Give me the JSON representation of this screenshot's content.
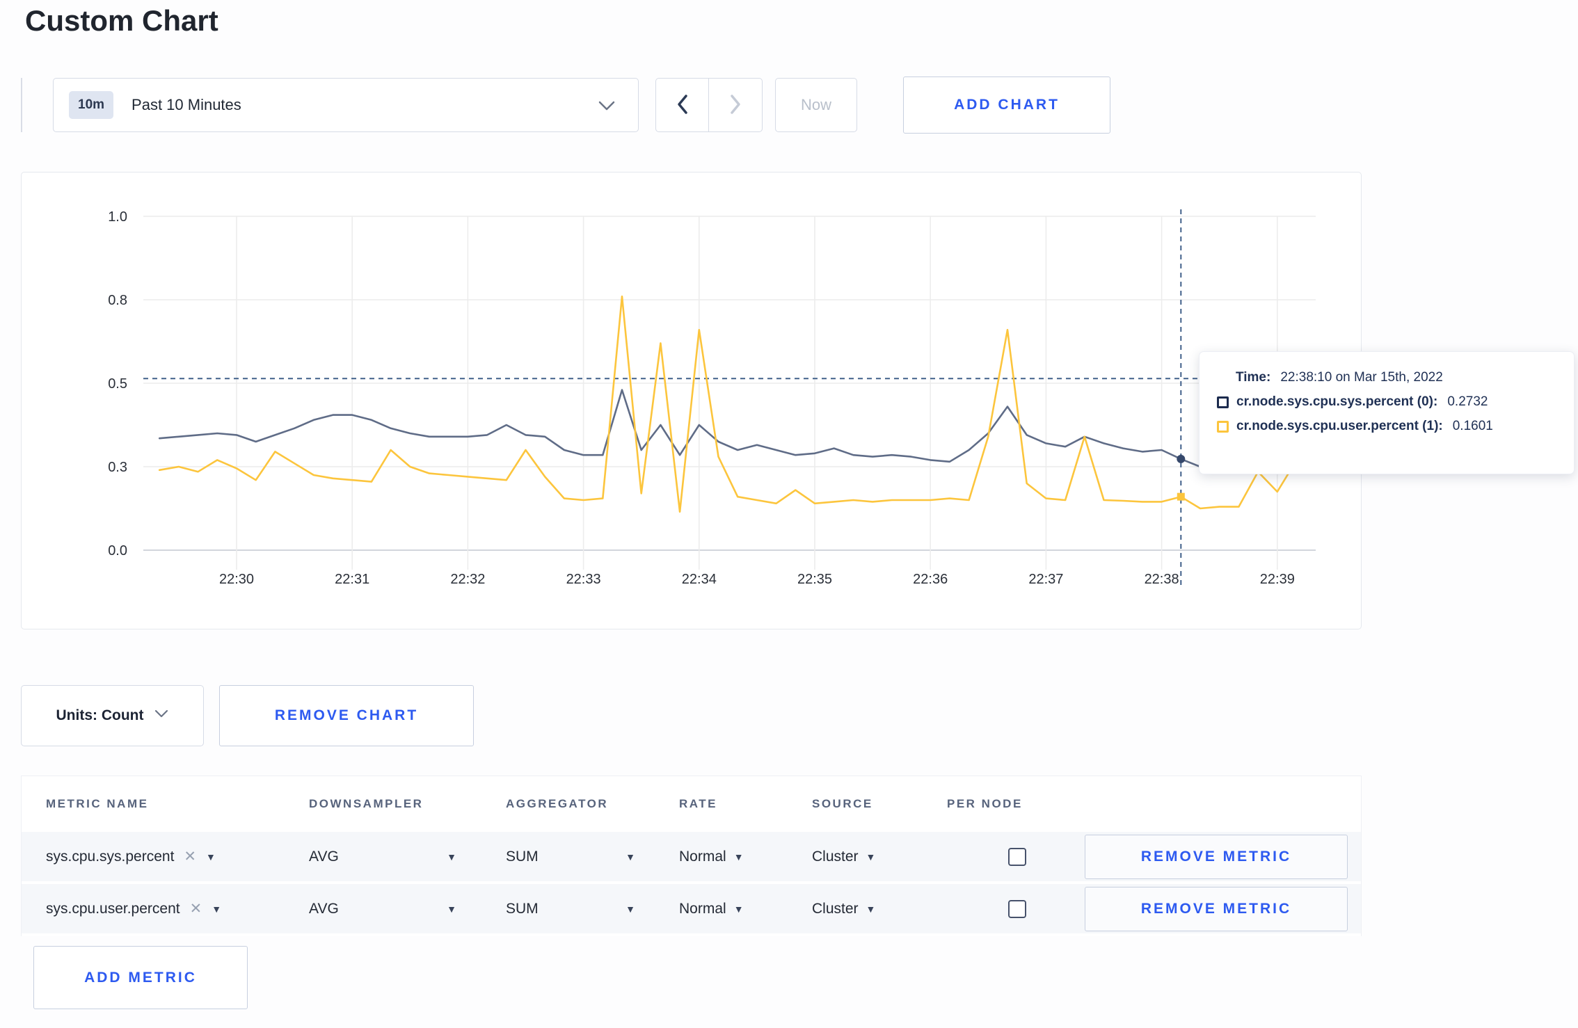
{
  "page": {
    "title": "Custom Chart"
  },
  "toolbar": {
    "time_badge": "10m",
    "time_label": "Past 10 Minutes",
    "now_label": "Now",
    "add_chart_label": "ADD CHART"
  },
  "chart": {
    "tooltip": {
      "time_label": "Time:",
      "time_value": "22:38:10 on Mar 15th, 2022",
      "series": [
        {
          "label": "cr.node.sys.cpu.sys.percent (0):",
          "value": "0.2732",
          "swatch_color": "#1c2b4e"
        },
        {
          "label": "cr.node.sys.cpu.user.percent (1):",
          "value": "0.1601",
          "swatch_color": "#fcc53d"
        }
      ]
    }
  },
  "chart_data": {
    "type": "line",
    "title": "",
    "xlabel": "",
    "ylabel": "",
    "ylim": [
      0,
      1
    ],
    "grid": true,
    "x_start": "22:29:20",
    "x_step_seconds": 10,
    "x_ticks": [
      "22:30",
      "22:31",
      "22:32",
      "22:33",
      "22:34",
      "22:35",
      "22:36",
      "22:37",
      "22:38",
      "22:39"
    ],
    "y_ticks": [
      {
        "value": 0,
        "label": "0.0"
      },
      {
        "value": 0.25,
        "label": "0.3"
      },
      {
        "value": 0.5,
        "label": "0.5"
      },
      {
        "value": 0.75,
        "label": "0.8"
      },
      {
        "value": 1,
        "label": "1.0"
      }
    ],
    "crosshair": {
      "x_index": 53,
      "time": "22:38:10",
      "h_line_value": 0.514
    },
    "series": [
      {
        "name": "cr.node.sys.cpu.sys.percent",
        "color": "#5f6c87",
        "marker_color": "#36486b",
        "values": [
          0.335,
          0.34,
          0.345,
          0.35,
          0.345,
          0.325,
          0.345,
          0.365,
          0.39,
          0.405,
          0.405,
          0.39,
          0.365,
          0.35,
          0.34,
          0.34,
          0.34,
          0.345,
          0.375,
          0.345,
          0.34,
          0.3,
          0.285,
          0.285,
          0.48,
          0.3,
          0.375,
          0.285,
          0.375,
          0.325,
          0.3,
          0.315,
          0.3,
          0.285,
          0.29,
          0.305,
          0.285,
          0.28,
          0.285,
          0.28,
          0.27,
          0.265,
          0.3,
          0.35,
          0.43,
          0.345,
          0.32,
          0.31,
          0.34,
          0.32,
          0.305,
          0.295,
          0.3,
          0.2732,
          0.25,
          0.27,
          0.28,
          0.3,
          0.3,
          0.31
        ]
      },
      {
        "name": "cr.node.sys.cpu.user.percent",
        "color": "#fcc53d",
        "marker_color": "#fcc53d",
        "values": [
          0.24,
          0.25,
          0.235,
          0.27,
          0.245,
          0.21,
          0.295,
          0.26,
          0.225,
          0.215,
          0.21,
          0.205,
          0.3,
          0.25,
          0.23,
          0.225,
          0.22,
          0.215,
          0.21,
          0.3,
          0.22,
          0.155,
          0.15,
          0.155,
          0.76,
          0.17,
          0.62,
          0.115,
          0.66,
          0.28,
          0.16,
          0.15,
          0.14,
          0.18,
          0.14,
          0.145,
          0.15,
          0.145,
          0.15,
          0.15,
          0.15,
          0.155,
          0.15,
          0.34,
          0.66,
          0.2,
          0.155,
          0.15,
          0.34,
          0.15,
          0.148,
          0.145,
          0.145,
          0.1601,
          0.125,
          0.13,
          0.13,
          0.235,
          0.175,
          0.27
        ]
      }
    ]
  },
  "chart_controls": {
    "units_label": "Units: Count",
    "remove_chart_label": "REMOVE CHART"
  },
  "metrics_table": {
    "headers": [
      "METRIC NAME",
      "DOWNSAMPLER",
      "AGGREGATOR",
      "RATE",
      "SOURCE",
      "PER NODE"
    ],
    "rows": [
      {
        "metric": "sys.cpu.sys.percent",
        "downsampler": "AVG",
        "aggregator": "SUM",
        "rate": "Normal",
        "source": "Cluster",
        "per_node_checked": false,
        "remove_label": "REMOVE METRIC"
      },
      {
        "metric": "sys.cpu.user.percent",
        "downsampler": "AVG",
        "aggregator": "SUM",
        "rate": "Normal",
        "source": "Cluster",
        "per_node_checked": false,
        "remove_label": "REMOVE METRIC"
      }
    ],
    "add_metric_label": "ADD METRIC"
  }
}
